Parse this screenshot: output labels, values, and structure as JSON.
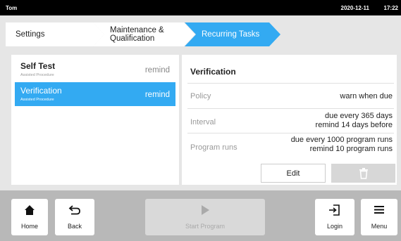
{
  "statusbar": {
    "user": "Tom",
    "date": "2020-12-11",
    "time": "17:22"
  },
  "breadcrumb": {
    "settings": "Settings",
    "maintenance_line1": "Maintenance &",
    "maintenance_line2": "Qualification",
    "recurring": "Recurring Tasks"
  },
  "tasks": [
    {
      "title": "Self Test",
      "subtitle": "Assisted Procedure",
      "status": "remind"
    },
    {
      "title": "Verification",
      "subtitle": "Assisted Procedure",
      "status": "remind",
      "selected": true
    }
  ],
  "detail": {
    "title": "Verification",
    "policy_label": "Policy",
    "policy_value": "warn when due",
    "interval_label": "Interval",
    "interval_line1": "due every 365 days",
    "interval_line2": "remind 14 days before",
    "runs_label": "Program runs",
    "runs_line1": "due every 1000 program runs",
    "runs_line2": "remind 10 program runs"
  },
  "actions": {
    "edit": "Edit",
    "delete_icon": "trash-icon"
  },
  "bottombar": {
    "home": "Home",
    "back": "Back",
    "start": "Start Program",
    "login": "Login",
    "menu": "Menu"
  },
  "colors": {
    "accent": "#33aaf2",
    "statusbar": "#000000",
    "disabled": "#d9d9d9"
  }
}
